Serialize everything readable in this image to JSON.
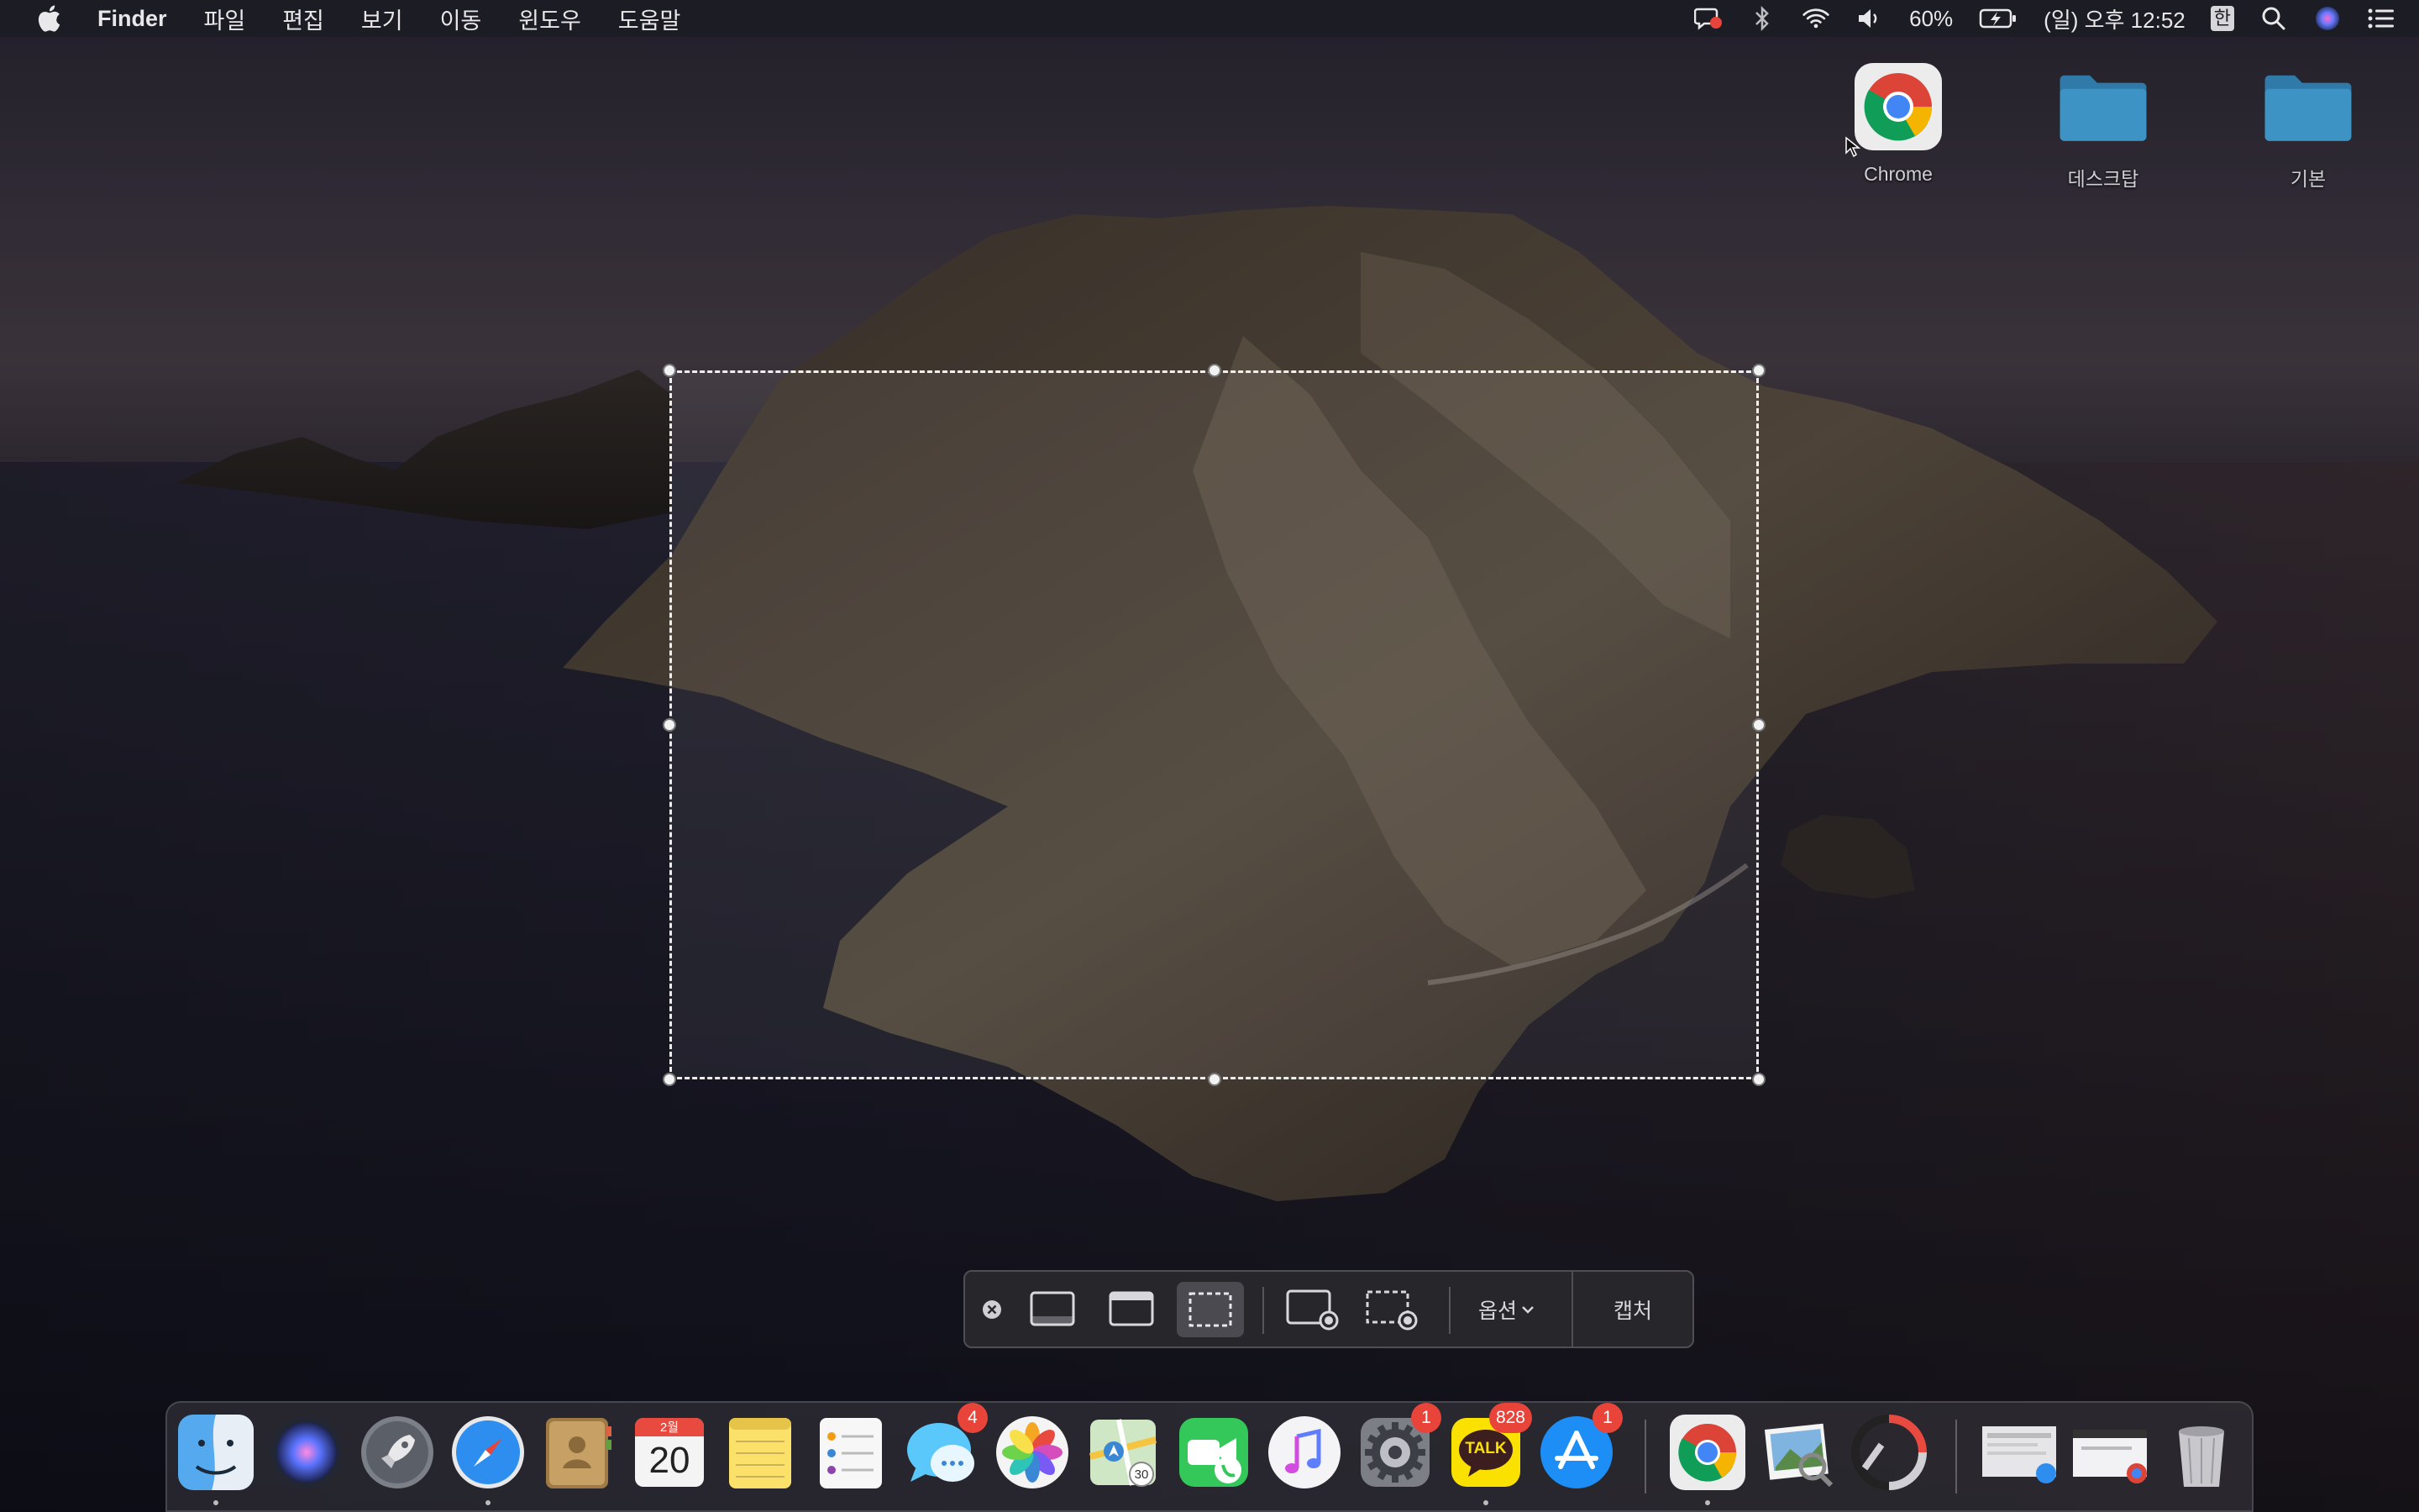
{
  "menubar": {
    "app_name": "Finder",
    "items": [
      "파일",
      "편집",
      "보기",
      "이동",
      "윈도우",
      "도움말"
    ],
    "status": {
      "battery": "60%",
      "datetime": "(일) 오후 12:52",
      "input_method": "한"
    }
  },
  "desktop_icons": [
    {
      "label": "Chrome",
      "icon": "chrome-icon"
    },
    {
      "label": "데스크탑",
      "icon": "folder-icon"
    },
    {
      "label": "기본",
      "icon": "folder-icon"
    }
  ],
  "screenshot_toolbar": {
    "options_label": "옵션",
    "capture_label": "캡처",
    "active_mode": "capture-selected-portion"
  },
  "dock": {
    "calendar_month": "2월",
    "calendar_day": "20",
    "maps_badge_text": "30",
    "kakaotalk_label": "TALK",
    "badges": {
      "messages": "4",
      "system_preferences": "1",
      "kakaotalk": "828",
      "app_store": "1"
    }
  },
  "colors": {
    "accent": "#3a87d6",
    "badge": "#e8443a",
    "menubar": "#1c1c24"
  }
}
